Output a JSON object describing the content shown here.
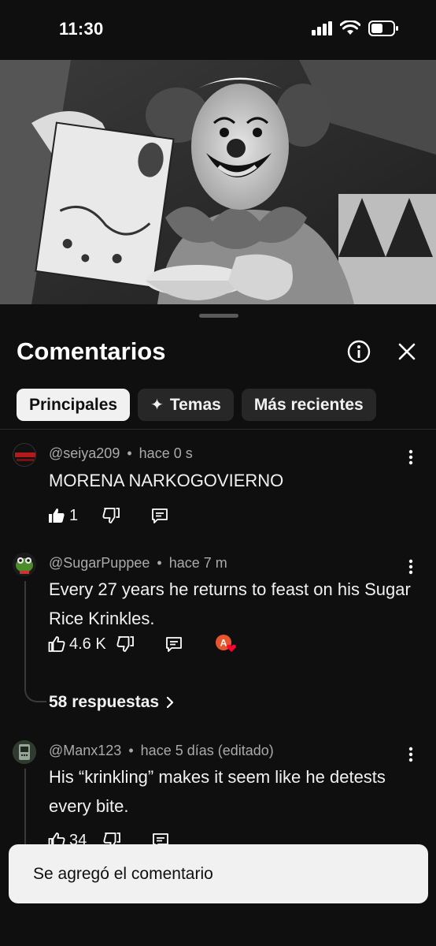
{
  "status": {
    "time": "11:30"
  },
  "sheet": {
    "title": "Comentarios",
    "chips": [
      {
        "label": "Principales",
        "active": true
      },
      {
        "label": "Temas",
        "icon": "sparkle-icon"
      },
      {
        "label": "Más recientes"
      }
    ]
  },
  "comments": [
    {
      "handle": "@seiya209",
      "separator": "•",
      "time": "hace 0 s",
      "text": "MORENA NARKOGOVIERNO",
      "likes": "1"
    },
    {
      "handle": "@SugarPuppee",
      "separator": "•",
      "time": "hace 7 m",
      "text": "Every 27 years he returns to feast on his Sugar Rice Krinkles.",
      "likes": "4.6 K",
      "replies": "58 respuestas",
      "creator_heart_initial": "A"
    },
    {
      "handle": "@Manx123",
      "separator": "•",
      "time": "hace 5 días (editado)",
      "text": "His “krinkling” makes it seem like he detests every bite.",
      "likes": "34"
    }
  ],
  "toast": {
    "text": "Se agregó el comentario"
  },
  "colors": {
    "background": "#0f0f0f",
    "chip": "#272727",
    "meta": "#aaaaaa",
    "heart": "#ff0033",
    "creator_avatar": "#e8542c"
  }
}
